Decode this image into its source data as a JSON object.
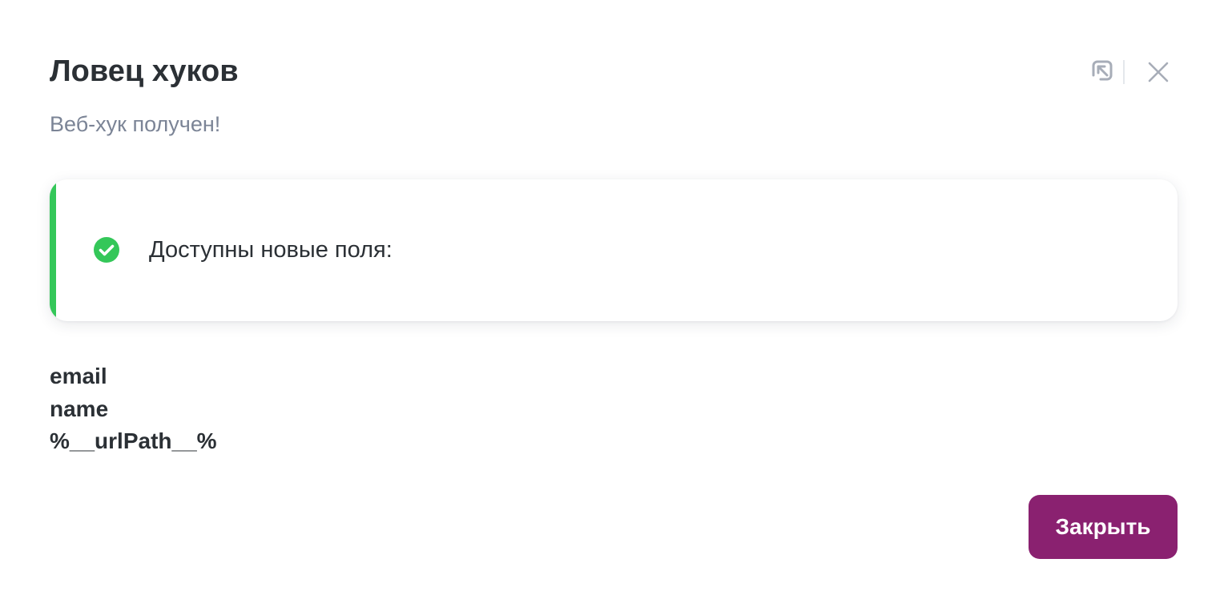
{
  "dialog": {
    "title": "Ловец хуков",
    "subtitle": "Веб-хук получен!",
    "header_icons": [
      "collapse-icon",
      "close-icon"
    ]
  },
  "notice": {
    "status": "success",
    "icon": "check-circle-icon",
    "text": "Доступны новые поля:"
  },
  "fields": [
    "email",
    "name",
    "%__urlPath__%"
  ],
  "footer": {
    "close_label": "Закрыть"
  },
  "colors": {
    "accent_success": "#34c759",
    "primary_button": "#8a2170",
    "title_text": "#2b3035",
    "subtitle_text": "#7b8496",
    "icon_gray": "#a7adb8"
  }
}
